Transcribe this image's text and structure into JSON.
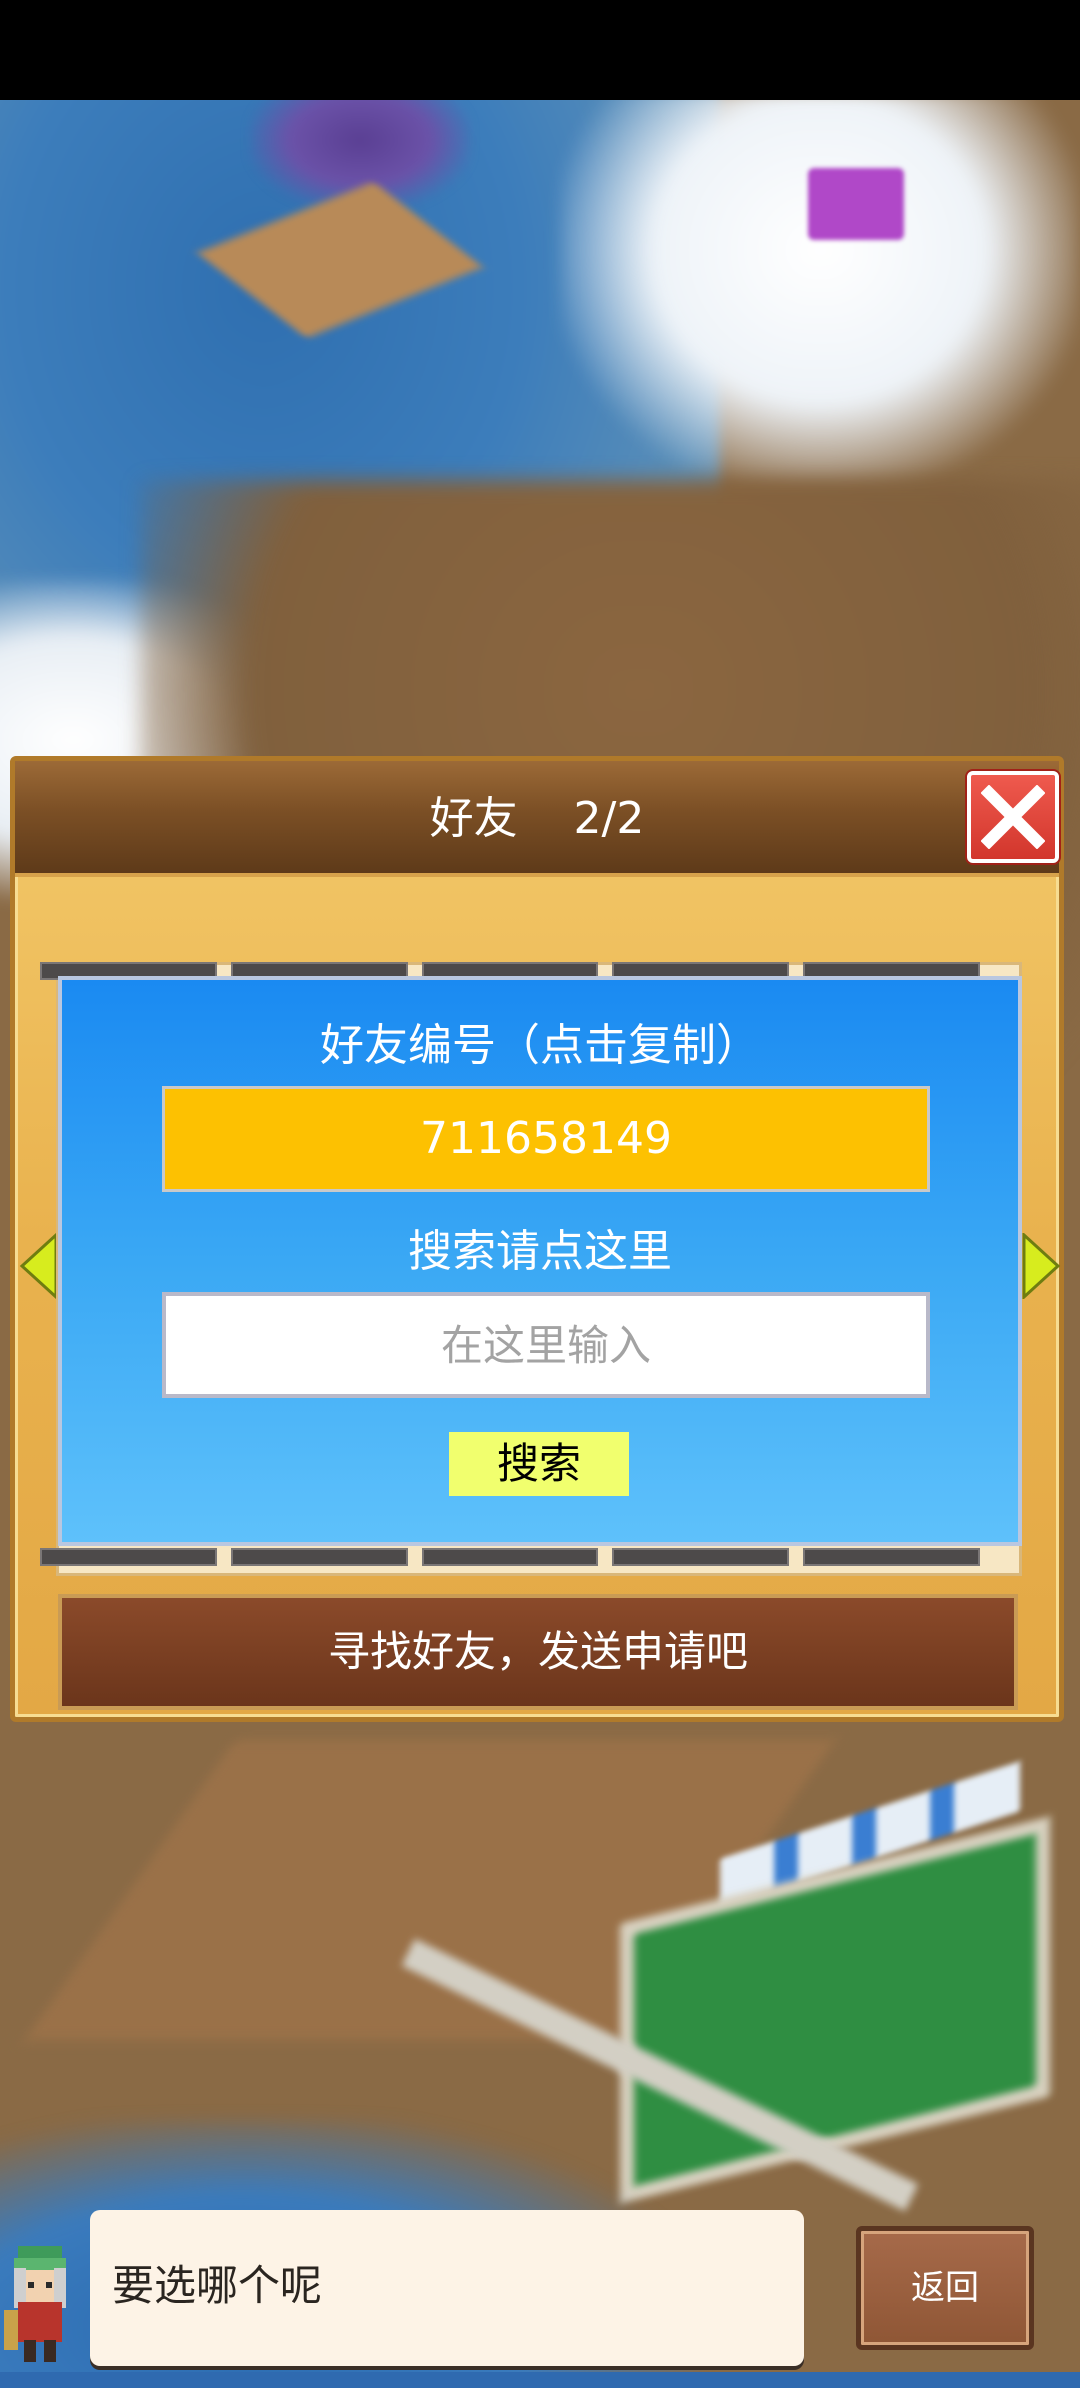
{
  "dialog": {
    "title": "好友    2/2",
    "close_icon": "close-x-icon"
  },
  "friend_code": {
    "label": "好友编号（点击复制）",
    "value": "711658149"
  },
  "search": {
    "label": "搜索请点这里",
    "placeholder": "在这里输入",
    "button_label": "搜索"
  },
  "find_friends": {
    "label": "寻找好友，发送申请吧"
  },
  "bottom": {
    "message": "要选哪个呢",
    "back_label": "返回"
  },
  "colors": {
    "dialog_frame": "#e9b24e",
    "header": "#7b4f25",
    "panel": "#3aa8f4",
    "code_box": "#fdc101",
    "search_button": "#f1ff6e",
    "close_button": "#d2362c"
  }
}
